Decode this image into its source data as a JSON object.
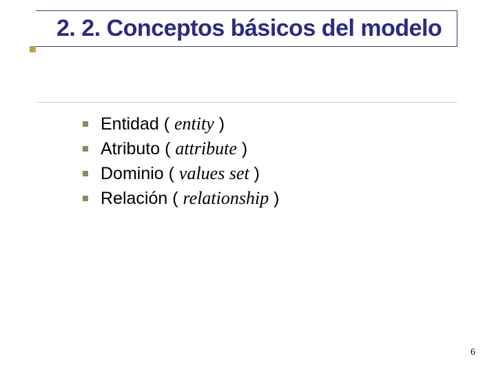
{
  "title": "2. 2. Conceptos básicos del modelo",
  "items": [
    {
      "term": "Entidad",
      "english": "entity"
    },
    {
      "term": "Atributo",
      "english": "attribute"
    },
    {
      "term": "Dominio",
      "english": "values set"
    },
    {
      "term": "Relación",
      "english": "relationship"
    }
  ],
  "pageNumber": "6"
}
